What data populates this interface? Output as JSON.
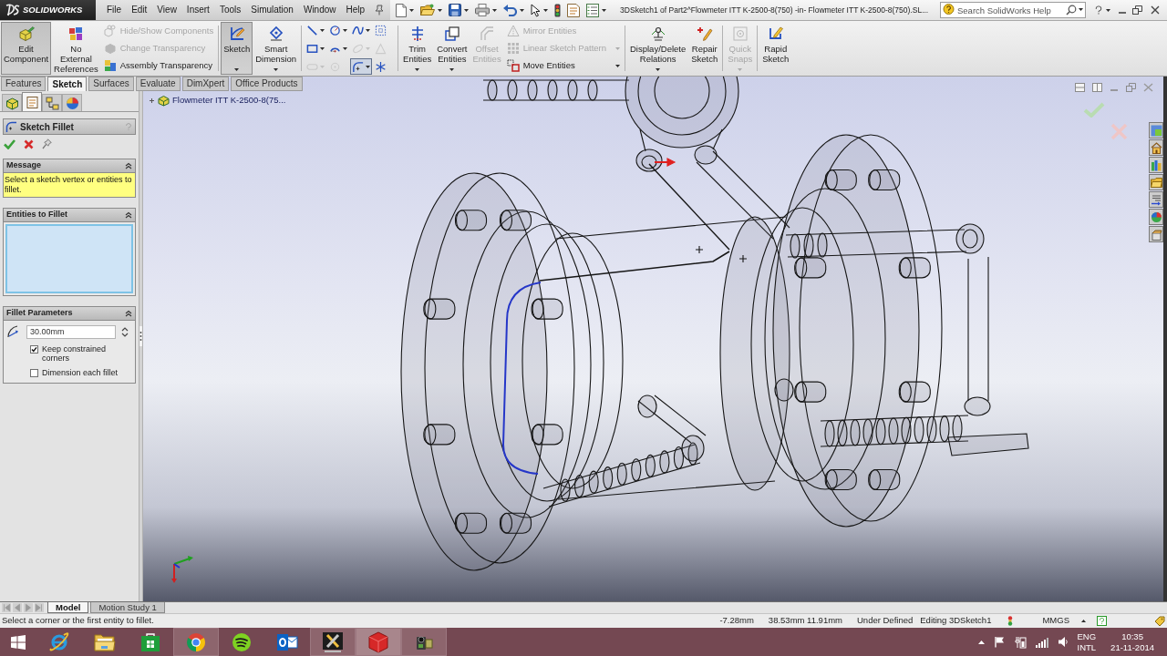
{
  "title_bar": {
    "logo": "SOLIDWORKS",
    "menu": [
      "File",
      "Edit",
      "View",
      "Insert",
      "Tools",
      "Simulation",
      "Window",
      "Help"
    ],
    "document_title": "3DSketch1 of Part2^Flowmeter ITT K-2500-8(750) -in- Flowmeter ITT K-2500-8(750).SL...",
    "search": {
      "placeholder": "Search SolidWorks Help"
    }
  },
  "command_manager": {
    "groups": [
      {
        "items": [
          {
            "kind": "large",
            "label": "Edit Component",
            "pressed": true,
            "disabled": false,
            "dropdown": false
          },
          {
            "kind": "large",
            "label": "No External References",
            "pressed": false,
            "disabled": false,
            "dropdown": false
          },
          {
            "kind": "stack",
            "rows": [
              {
                "label": "Hide/Show Components",
                "disabled": true,
                "dropdown": false
              },
              {
                "label": "Change Transparency",
                "disabled": true,
                "dropdown": false
              },
              {
                "label": "Assembly Transparency",
                "disabled": false,
                "dropdown": false
              }
            ]
          }
        ]
      },
      {
        "items": [
          {
            "kind": "large",
            "label": "Sketch",
            "pressed": true,
            "disabled": false,
            "dropdown": true
          },
          {
            "kind": "large",
            "label": "Smart Dimension",
            "pressed": false,
            "disabled": false,
            "dropdown": true
          }
        ]
      },
      {
        "items": [
          {
            "kind": "tools",
            "tools": [
              {
                "pressed": false,
                "disabled": false,
                "dropdown": true
              },
              {
                "pressed": false,
                "disabled": false,
                "dropdown": true
              },
              {
                "pressed": false,
                "disabled": false,
                "dropdown": true
              },
              {
                "pressed": false,
                "disabled": false,
                "dropdown": false
              },
              {
                "pressed": false,
                "disabled": false,
                "dropdown": true
              },
              {
                "pressed": false,
                "disabled": false,
                "dropdown": true
              },
              {
                "pressed": false,
                "disabled": true,
                "dropdown": true
              },
              {
                "pressed": false,
                "disabled": true,
                "dropdown": false
              },
              {
                "pressed": false,
                "disabled": true,
                "dropdown": true
              },
              {
                "pressed": false,
                "disabled": true,
                "dropdown": false
              },
              {
                "pressed": true,
                "disabled": false,
                "dropdown": true
              },
              {
                "pressed": false,
                "disabled": false,
                "dropdown": false
              }
            ]
          }
        ]
      },
      {
        "items": [
          {
            "kind": "large",
            "label": "Trim Entities",
            "pressed": false,
            "disabled": false,
            "dropdown": true
          },
          {
            "kind": "large",
            "label": "Convert Entities",
            "pressed": false,
            "disabled": false,
            "dropdown": true
          },
          {
            "kind": "large",
            "label": "Offset Entities",
            "pressed": false,
            "disabled": true,
            "dropdown": false
          },
          {
            "kind": "stack",
            "rows": [
              {
                "label": "Mirror Entities",
                "disabled": true,
                "dropdown": false
              },
              {
                "label": "Linear Sketch Pattern",
                "disabled": true,
                "dropdown": true
              },
              {
                "label": "Move Entities",
                "disabled": false,
                "dropdown": true
              }
            ]
          }
        ]
      },
      {
        "items": [
          {
            "kind": "large",
            "label": "Display/Delete Relations",
            "pressed": false,
            "disabled": false,
            "dropdown": true
          },
          {
            "kind": "large",
            "label": "Repair Sketch",
            "pressed": false,
            "disabled": false,
            "dropdown": false
          }
        ]
      },
      {
        "items": [
          {
            "kind": "large",
            "label": "Quick Snaps",
            "pressed": false,
            "disabled": true,
            "dropdown": true
          }
        ]
      },
      {
        "items": [
          {
            "kind": "large",
            "label": "Rapid Sketch",
            "pressed": false,
            "disabled": false,
            "dropdown": false
          }
        ]
      }
    ]
  },
  "tabs": [
    {
      "label": "Features",
      "selected": false
    },
    {
      "label": "Sketch",
      "selected": true
    },
    {
      "label": "Surfaces",
      "selected": false
    },
    {
      "label": "Evaluate",
      "selected": false
    },
    {
      "label": "DimXpert",
      "selected": false
    },
    {
      "label": "Office Products",
      "selected": false
    }
  ],
  "property_manager": {
    "tabs": [
      {
        "selected": false
      },
      {
        "selected": true
      },
      {
        "selected": false
      },
      {
        "selected": false
      }
    ],
    "title": "Sketch Fillet",
    "groups": [
      {
        "kind": "message",
        "title": "Message",
        "expanded": true,
        "text": "Select a sketch vertex or entities to fillet."
      },
      {
        "kind": "selection",
        "title": "Entities to Fillet",
        "expanded": true
      },
      {
        "kind": "parameters",
        "title": "Fillet Parameters",
        "expanded": true,
        "radius": "30.00mm",
        "options": [
          {
            "label": "Keep constrained corners",
            "checked": true
          },
          {
            "label": "Dimension each fillet",
            "checked": false
          }
        ]
      }
    ]
  },
  "viewport": {
    "tree_item": {
      "label": "Flowmeter ITT K-2500-8(75...",
      "expanded": false
    }
  },
  "bottom_tabs": [
    {
      "label": "Model",
      "selected": true
    },
    {
      "label": "Motion Study 1",
      "selected": false
    }
  ],
  "status_bar": {
    "message": "Select a corner or the first entity to fillet.",
    "fields": [
      "-7.28mm",
      "38.53mm 11.91mm",
      "Under Defined",
      "Editing 3DSketch1"
    ],
    "units": "MMGS"
  },
  "taskbar": {
    "apps": [
      {
        "running": false,
        "selected": false
      },
      {
        "running": false,
        "selected": false
      },
      {
        "running": false,
        "selected": false
      },
      {
        "running": true,
        "selected": false
      },
      {
        "running": false,
        "selected": false
      },
      {
        "running": false,
        "selected": false
      },
      {
        "running": true,
        "selected": false
      },
      {
        "running": true,
        "selected": true
      },
      {
        "running": true,
        "selected": false
      }
    ],
    "tray": {
      "language": "ENG",
      "layout": "INTL",
      "time": "10:35",
      "date": "21-11-2014"
    }
  }
}
